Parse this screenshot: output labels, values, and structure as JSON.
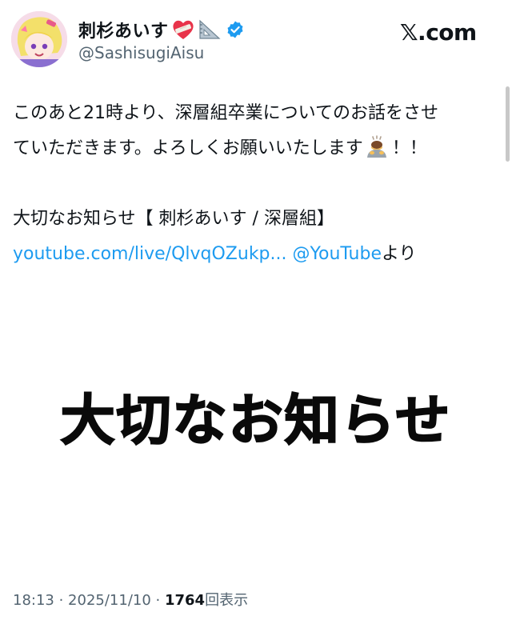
{
  "author": {
    "display_name": "刺杉あいす",
    "handle": "@SashisugiAisu",
    "verified": true,
    "emoji_icons": [
      "heart-bandaged-icon",
      "triangle-ruler-icon"
    ]
  },
  "brand": {
    "label": "𝕏.com",
    "icon": "x-logo-icon"
  },
  "tweet": {
    "line1": "このあと21時より、深層組卒業についてのお話をさせ",
    "line2_before_emoji": "ていただきます。よろしくお願いいたします",
    "line2_emoji": "person-bowing-icon",
    "line2_after_emoji": "！！",
    "line3": "大切なお知らせ【 刺杉あいす /  深層組】",
    "link_url": "youtube.com/live/QlvqOZukp...",
    "link_mention": "@YouTube",
    "link_suffix": "より"
  },
  "media": {
    "heading": "大切なお知らせ"
  },
  "meta": {
    "time": "18:13",
    "separator": " · ",
    "date": "2025/11/10",
    "views_count": "1764",
    "views_label": "回表示"
  },
  "colors": {
    "link": "#1d9bf0",
    "verified": "#1d9bf0",
    "muted": "#536471",
    "text": "#0f1419"
  }
}
